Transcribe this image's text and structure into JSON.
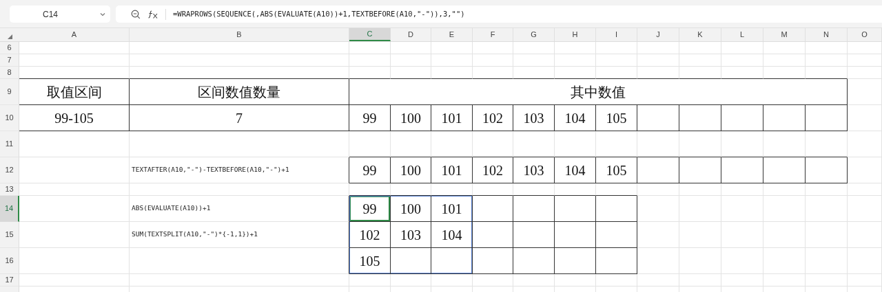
{
  "name_box": "C14",
  "formula": "=WRAPROWS(SEQUENCE(,ABS(EVALUATE(A10))+1,TEXTBEFORE(A10,\"-\")),3,\"\")",
  "columns": [
    {
      "label": "A",
      "selected": false
    },
    {
      "label": "B",
      "selected": false
    },
    {
      "label": "C",
      "selected": true
    },
    {
      "label": "D",
      "selected": false
    },
    {
      "label": "E",
      "selected": false
    },
    {
      "label": "F",
      "selected": false
    },
    {
      "label": "G",
      "selected": false
    },
    {
      "label": "H",
      "selected": false
    },
    {
      "label": "I",
      "selected": false
    },
    {
      "label": "J",
      "selected": false
    },
    {
      "label": "K",
      "selected": false
    },
    {
      "label": "L",
      "selected": false
    },
    {
      "label": "M",
      "selected": false
    },
    {
      "label": "N",
      "selected": false
    },
    {
      "label": "O",
      "selected": false
    }
  ],
  "rows": [
    {
      "number": "6",
      "kind": "short",
      "selected": false,
      "cells": []
    },
    {
      "number": "7",
      "kind": "short",
      "selected": false,
      "cells": []
    },
    {
      "number": "8",
      "kind": "short",
      "selected": false,
      "cells": []
    },
    {
      "number": "9",
      "kind": "tall",
      "selected": false,
      "cells": [
        {
          "kind": "value",
          "text": "取值区间",
          "bordered": true,
          "selected": false,
          "in_range": false
        },
        {
          "kind": "value",
          "text": "区间数值数量",
          "bordered": true,
          "selected": false,
          "in_range": false
        },
        {
          "kind": "wide",
          "text": "其中数值",
          "bordered": true,
          "selected": false,
          "in_range": false
        }
      ]
    },
    {
      "number": "10",
      "kind": "tall",
      "selected": false,
      "cells": [
        {
          "kind": "value",
          "text": "99-105",
          "bordered": true,
          "selected": false,
          "in_range": false
        },
        {
          "kind": "value",
          "text": "7",
          "bordered": true,
          "selected": false,
          "in_range": false
        },
        {
          "kind": "value",
          "text": "99",
          "bordered": true,
          "selected": false,
          "in_range": false
        },
        {
          "kind": "value",
          "text": "100",
          "bordered": true,
          "selected": false,
          "in_range": false
        },
        {
          "kind": "value",
          "text": "101",
          "bordered": true,
          "selected": false,
          "in_range": false
        },
        {
          "kind": "value",
          "text": "102",
          "bordered": true,
          "selected": false,
          "in_range": false
        },
        {
          "kind": "value",
          "text": "103",
          "bordered": true,
          "selected": false,
          "in_range": false
        },
        {
          "kind": "value",
          "text": "104",
          "bordered": true,
          "selected": false,
          "in_range": false
        },
        {
          "kind": "value",
          "text": "105",
          "bordered": true,
          "selected": false,
          "in_range": false
        },
        {
          "kind": "value",
          "bordered": true,
          "selected": false,
          "in_range": false
        },
        {
          "kind": "value",
          "bordered": true,
          "selected": false,
          "in_range": false
        },
        {
          "kind": "value",
          "bordered": true,
          "selected": false,
          "in_range": false
        },
        {
          "kind": "value",
          "bordered": true,
          "selected": false,
          "in_range": false
        },
        {
          "kind": "value",
          "bordered": true,
          "selected": false,
          "in_range": false
        }
      ]
    },
    {
      "number": "11",
      "kind": "tall",
      "selected": false,
      "cells": []
    },
    {
      "number": "12",
      "kind": "tall",
      "selected": false,
      "cells": [
        {
          "kind": "value",
          "bordered": false,
          "selected": false,
          "in_range": false
        },
        {
          "kind": "note",
          "text": "TEXTAFTER(A10,\"-\")-TEXTBEFORE(A10,\"-\")+1",
          "bordered": false,
          "selected": false,
          "in_range": false
        },
        {
          "kind": "value",
          "text": "99",
          "bordered": true,
          "selected": false,
          "in_range": false
        },
        {
          "kind": "value",
          "text": "100",
          "bordered": true,
          "selected": false,
          "in_range": false
        },
        {
          "kind": "value",
          "text": "101",
          "bordered": true,
          "selected": false,
          "in_range": false
        },
        {
          "kind": "value",
          "text": "102",
          "bordered": true,
          "selected": false,
          "in_range": false
        },
        {
          "kind": "value",
          "text": "103",
          "bordered": true,
          "selected": false,
          "in_range": false
        },
        {
          "kind": "value",
          "text": "104",
          "bordered": true,
          "selected": false,
          "in_range": false
        },
        {
          "kind": "value",
          "text": "105",
          "bordered": true,
          "selected": false,
          "in_range": false
        },
        {
          "kind": "value",
          "bordered": true,
          "selected": false,
          "in_range": false
        },
        {
          "kind": "value",
          "bordered": true,
          "selected": false,
          "in_range": false
        },
        {
          "kind": "value",
          "bordered": true,
          "selected": false,
          "in_range": false
        },
        {
          "kind": "value",
          "bordered": true,
          "selected": false,
          "in_range": false
        },
        {
          "kind": "value",
          "bordered": true,
          "selected": false,
          "in_range": false
        }
      ]
    },
    {
      "number": "13",
      "kind": "short",
      "selected": false,
      "cells": []
    },
    {
      "number": "14",
      "kind": "tall",
      "selected": true,
      "cells": [
        {
          "kind": "value",
          "bordered": false,
          "selected": false,
          "in_range": false
        },
        {
          "kind": "note",
          "text": "ABS(EVALUATE(A10))+1",
          "bordered": false,
          "selected": false,
          "in_range": false
        },
        {
          "kind": "value",
          "text": "99",
          "bordered": true,
          "selected": true,
          "in_range": true
        },
        {
          "kind": "value",
          "text": "100",
          "bordered": true,
          "selected": false,
          "in_range": true
        },
        {
          "kind": "value",
          "text": "101",
          "bordered": true,
          "selected": false,
          "in_range": true
        },
        {
          "kind": "value",
          "bordered": true,
          "selected": false,
          "in_range": false
        },
        {
          "kind": "value",
          "bordered": true,
          "selected": false,
          "in_range": false
        },
        {
          "kind": "value",
          "bordered": true,
          "selected": false,
          "in_range": false
        },
        {
          "kind": "value",
          "bordered": true,
          "selected": false,
          "in_range": false
        }
      ]
    },
    {
      "number": "15",
      "kind": "tall",
      "selected": false,
      "cells": [
        {
          "kind": "value",
          "bordered": false,
          "selected": false,
          "in_range": false
        },
        {
          "kind": "note",
          "text": "SUM(TEXTSPLIT(A10,\"-\")*{-1,1})+1",
          "bordered": false,
          "selected": false,
          "in_range": false
        },
        {
          "kind": "value",
          "text": "102",
          "bordered": true,
          "selected": false,
          "in_range": true
        },
        {
          "kind": "value",
          "text": "103",
          "bordered": true,
          "selected": false,
          "in_range": true
        },
        {
          "kind": "value",
          "text": "104",
          "bordered": true,
          "selected": false,
          "in_range": true
        },
        {
          "kind": "value",
          "bordered": true,
          "selected": false,
          "in_range": false
        },
        {
          "kind": "value",
          "bordered": true,
          "selected": false,
          "in_range": false
        },
        {
          "kind": "value",
          "bordered": true,
          "selected": false,
          "in_range": false
        },
        {
          "kind": "value",
          "bordered": true,
          "selected": false,
          "in_range": false
        }
      ]
    },
    {
      "number": "16",
      "kind": "tall",
      "selected": false,
      "cells": [
        {
          "kind": "value",
          "bordered": false,
          "selected": false,
          "in_range": false
        },
        {
          "kind": "value",
          "bordered": false,
          "selected": false,
          "in_range": false
        },
        {
          "kind": "value",
          "text": "105",
          "bordered": true,
          "selected": false,
          "in_range": true
        },
        {
          "kind": "value",
          "bordered": true,
          "selected": false,
          "in_range": true
        },
        {
          "kind": "value",
          "bordered": true,
          "selected": false,
          "in_range": true
        },
        {
          "kind": "value",
          "bordered": true,
          "selected": false,
          "in_range": false
        },
        {
          "kind": "value",
          "bordered": true,
          "selected": false,
          "in_range": false
        },
        {
          "kind": "value",
          "bordered": true,
          "selected": false,
          "in_range": false
        },
        {
          "kind": "value",
          "bordered": true,
          "selected": false,
          "in_range": false
        }
      ]
    },
    {
      "number": "17",
      "kind": "short",
      "selected": false,
      "cells": []
    }
  ]
}
